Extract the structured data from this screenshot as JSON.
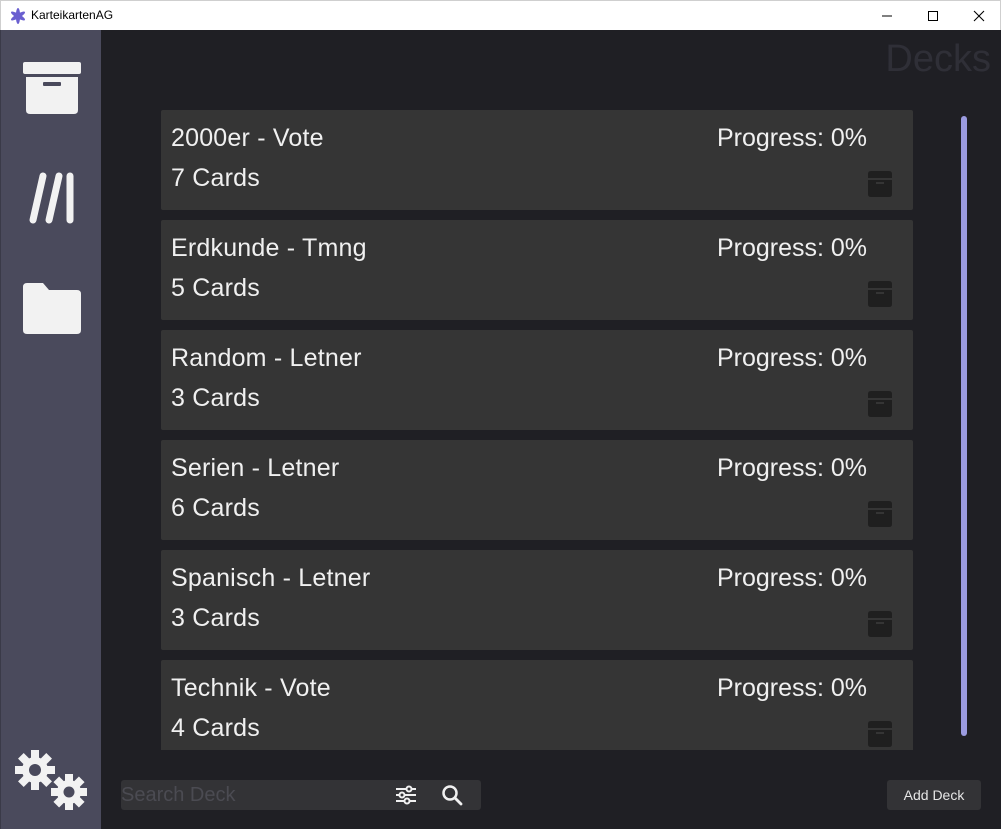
{
  "window": {
    "title": "KarteikartenAG",
    "app_icon": "star-logo-icon",
    "controls": [
      "minimize-icon",
      "maximize-icon",
      "close-icon"
    ]
  },
  "sidebar": {
    "items": [
      {
        "name": "archive-box-icon"
      },
      {
        "name": "library-stack-icon"
      },
      {
        "name": "folder-icon"
      },
      {
        "name": "settings-gears-icon"
      }
    ]
  },
  "main": {
    "heading": "Decks",
    "decks": [
      {
        "name": "2000er - Vote",
        "count": "7 Cards",
        "progress": "Progress: 0%"
      },
      {
        "name": "Erdkunde - Tmng",
        "count": "5 Cards",
        "progress": "Progress: 0%"
      },
      {
        "name": "Random - Letner",
        "count": "3 Cards",
        "progress": "Progress: 0%"
      },
      {
        "name": "Serien - Letner",
        "count": "6 Cards",
        "progress": "Progress: 0%"
      },
      {
        "name": "Spanisch - Letner",
        "count": "3 Cards",
        "progress": "Progress: 0%"
      },
      {
        "name": "Technik - Vote",
        "count": "4 Cards",
        "progress": "Progress: 0%"
      }
    ]
  },
  "bottom": {
    "search_placeholder": "Search Deck",
    "search_value": "",
    "filter_icon": "sliders-filter-icon",
    "search_icon": "search-icon",
    "add_label": "Add Deck"
  },
  "colors": {
    "sidebar": "#4a4a5c",
    "background": "#1f1f24",
    "card": "#353535",
    "scrollbar": "#9b9be0",
    "text": "#f0f0f0"
  }
}
